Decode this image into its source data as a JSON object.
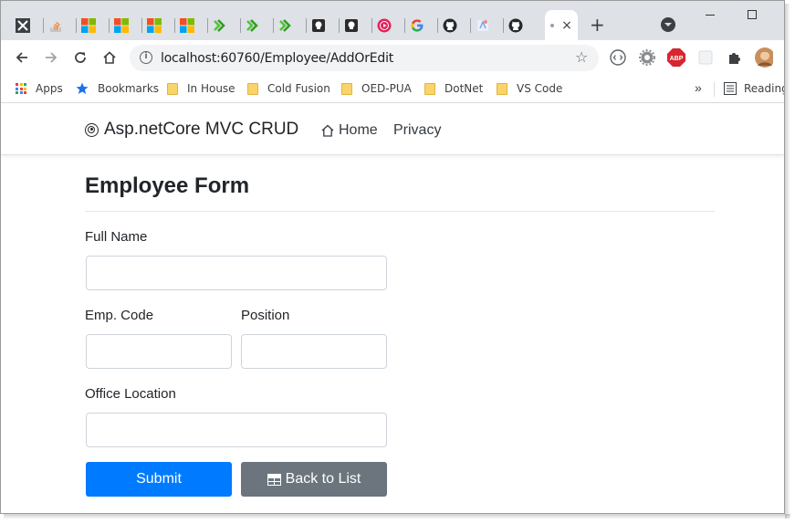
{
  "browser": {
    "tabs": [
      {
        "icon": "x-square-icon"
      },
      {
        "icon": "stackoverflow-icon"
      },
      {
        "icon": "microsoft-icon"
      },
      {
        "icon": "microsoft-icon"
      },
      {
        "icon": "microsoft-icon"
      },
      {
        "icon": "microsoft-icon"
      },
      {
        "icon": "green-arrow-icon"
      },
      {
        "icon": "green-arrow-icon"
      },
      {
        "icon": "green-arrow-icon"
      },
      {
        "icon": "dark-doc-icon"
      },
      {
        "icon": "dark-doc-icon"
      },
      {
        "icon": "red-play-icon"
      },
      {
        "icon": "google-icon"
      },
      {
        "icon": "github-icon"
      },
      {
        "icon": "blue-app-icon"
      },
      {
        "icon": "github-icon"
      }
    ],
    "active_tab_close": "×",
    "new_tab_label": "+",
    "address": "localhost:60760/Employee/AddOrEdit",
    "bookmarks": [
      {
        "label": "Apps",
        "icon": "apps-grid-icon"
      },
      {
        "label": "Bookmarks",
        "icon": "star-icon"
      },
      {
        "label": "In House",
        "icon": "folder-icon"
      },
      {
        "label": "Cold Fusion",
        "icon": "folder-icon"
      },
      {
        "label": "OED-PUA",
        "icon": "folder-icon"
      },
      {
        "label": "DotNet",
        "icon": "folder-icon"
      },
      {
        "label": "VS Code",
        "icon": "folder-icon"
      }
    ],
    "bookmarks_more": "»",
    "reading_list": "Reading"
  },
  "app": {
    "brand": "Asp.netCore MVC CRUD",
    "nav_home": "Home",
    "nav_privacy": "Privacy"
  },
  "form": {
    "title": "Employee Form",
    "full_name_label": "Full Name",
    "full_name_value": "",
    "emp_code_label": "Emp. Code",
    "emp_code_value": "",
    "position_label": "Position",
    "position_value": "",
    "office_location_label": "Office Location",
    "office_location_value": "",
    "submit_label": "Submit",
    "back_label": "Back to List"
  },
  "colors": {
    "primary": "#007bff",
    "secondary": "#6c757d",
    "tabstrip": "#dee1e6"
  }
}
